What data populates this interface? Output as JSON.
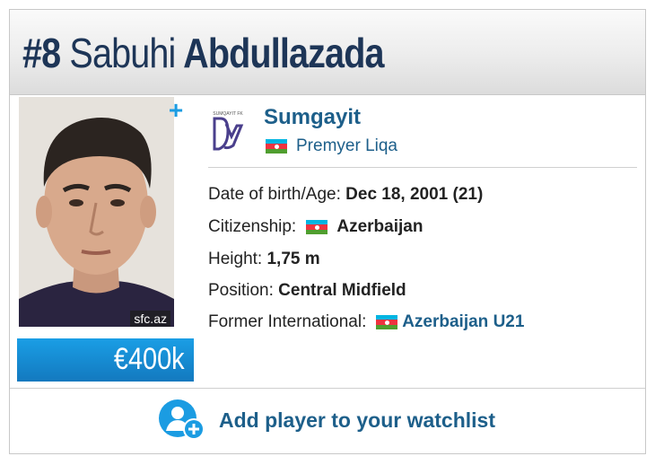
{
  "header": {
    "number": "#8",
    "first_name": "Sabuhi",
    "last_name": "Abdullazada"
  },
  "photo": {
    "credit": "sfc.az"
  },
  "market_value": "€400k",
  "add_button_label": "+",
  "club": {
    "name": "Sumgayit",
    "logo_text": "SUMQAYIT FK",
    "league": "Premyer Liqa"
  },
  "info": {
    "dob_label": "Date of birth/Age:",
    "dob_value": "Dec 18, 2001 (21)",
    "citizenship_label": "Citizenship:",
    "citizenship_value": "Azerbaijan",
    "height_label": "Height:",
    "height_value": "1,75 m",
    "position_label": "Position:",
    "position_value": "Central Midfield",
    "former_intl_label": "Former International:",
    "former_intl_value": "Azerbaijan U21"
  },
  "watchlist": {
    "label": "Add player to your watchlist"
  },
  "colors": {
    "brand_dark": "#1d3557",
    "link": "#1d5f8a",
    "accent": "#1b9ce2"
  }
}
